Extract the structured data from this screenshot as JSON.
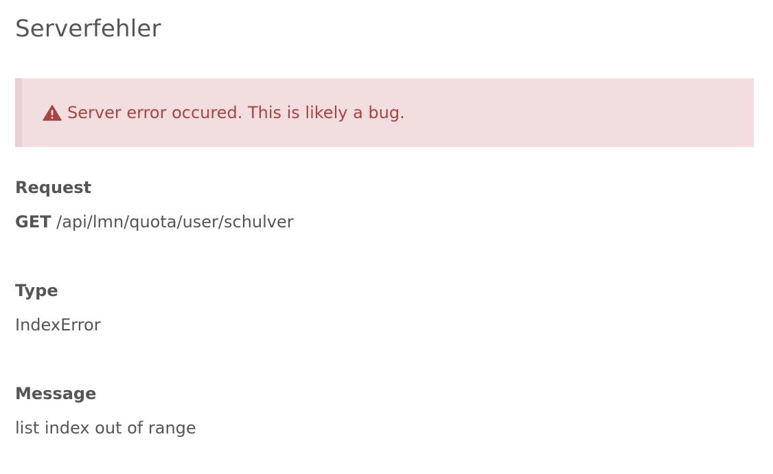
{
  "page": {
    "title": "Serverfehler"
  },
  "alert": {
    "icon": "warning-triangle-icon",
    "message": "Server error occured. This is likely a bug.",
    "text_color": "#a94442",
    "background_color": "#f2dede"
  },
  "request": {
    "label": "Request",
    "method": "GET",
    "path": "/api/lmn/quota/user/schulver"
  },
  "type": {
    "label": "Type",
    "value": "IndexError"
  },
  "message": {
    "label": "Message",
    "value": "list index out of range"
  }
}
